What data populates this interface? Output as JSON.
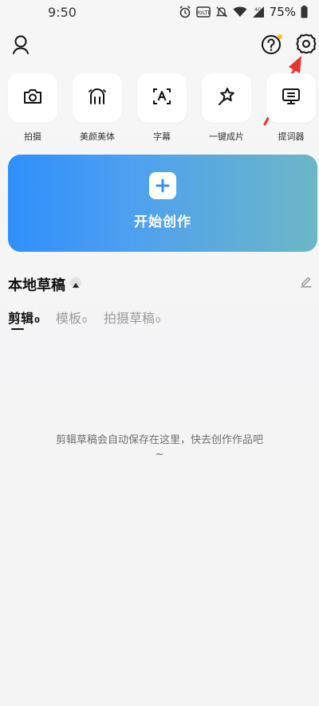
{
  "status_bar": {
    "time": "9:50",
    "battery": "75%",
    "icons": [
      "alarm-icon",
      "volte-icon",
      "mute-icon",
      "wifi-icon",
      "4g-signal-icon",
      "battery-icon"
    ]
  },
  "top_bar": {
    "icons": [
      "profile-icon",
      "help-icon",
      "settings-icon"
    ],
    "notification_dot_color": "#f5c518"
  },
  "tools": [
    {
      "label": "拍摄",
      "icon": "camera-icon"
    },
    {
      "label": "美颜美体",
      "icon": "beauty-icon"
    },
    {
      "label": "字幕",
      "icon": "caption-icon"
    },
    {
      "label": "一键成片",
      "icon": "magic-icon"
    },
    {
      "label": "提词器",
      "icon": "teleprompter-icon"
    }
  ],
  "create_card": {
    "label": "开始创作",
    "gradient_start": "#2f8ffb",
    "gradient_end": "#6cb7c6"
  },
  "drafts": {
    "title": "本地草稿",
    "tabs": [
      {
        "label": "剪辑",
        "count": "0",
        "active": true
      },
      {
        "label": "模板",
        "count": "0",
        "active": false
      },
      {
        "label": "拍摄草稿",
        "count": "0",
        "active": false
      }
    ],
    "empty_message": "剪辑草稿会自动保存在这里，快去创作作品吧",
    "empty_message_tail": "~"
  },
  "colors": {
    "annotation_arrow": "#e8322b"
  }
}
